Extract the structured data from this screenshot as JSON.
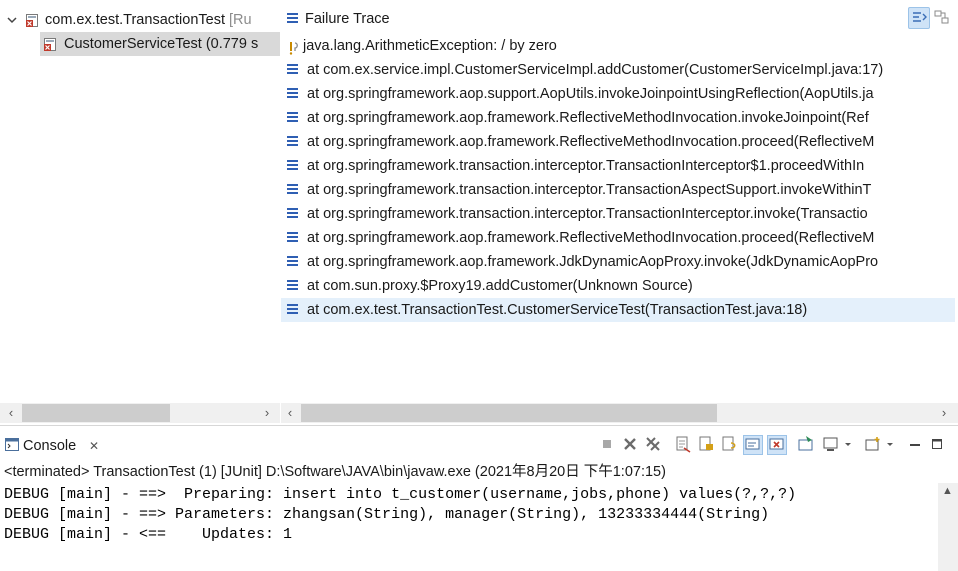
{
  "tree": {
    "suite_label": "com.ex.test.TransactionTest",
    "suite_suffix": "[Ru",
    "test_label": "CustomerServiceTest (0.779 s"
  },
  "trace": {
    "title": "Failure Trace",
    "exception": "java.lang.ArithmeticException: / by zero",
    "frames": [
      "at com.ex.service.impl.CustomerServiceImpl.addCustomer(CustomerServiceImpl.java:17)",
      "at org.springframework.aop.support.AopUtils.invokeJoinpointUsingReflection(AopUtils.ja",
      "at org.springframework.aop.framework.ReflectiveMethodInvocation.invokeJoinpoint(Ref",
      "at org.springframework.aop.framework.ReflectiveMethodInvocation.proceed(ReflectiveM",
      "at org.springframework.transaction.interceptor.TransactionInterceptor$1.proceedWithIn",
      "at org.springframework.transaction.interceptor.TransactionAspectSupport.invokeWithinT",
      "at org.springframework.transaction.interceptor.TransactionInterceptor.invoke(Transactio",
      "at org.springframework.aop.framework.ReflectiveMethodInvocation.proceed(ReflectiveM",
      "at org.springframework.aop.framework.JdkDynamicAopProxy.invoke(JdkDynamicAopPro",
      "at com.sun.proxy.$Proxy19.addCustomer(Unknown Source)",
      "at com.ex.test.TransactionTest.CustomerServiceTest(TransactionTest.java:18)"
    ],
    "selected_index": 10
  },
  "console": {
    "tab_label": "Console",
    "close_glyph": "✕",
    "status": "<terminated> TransactionTest (1) [JUnit] D:\\Software\\JAVA\\bin\\javaw.exe (2021年8月20日 下午1:07:15)",
    "lines": [
      "DEBUG [main] - ==>  Preparing: insert into t_customer(username,jobs,phone) values(?,?,?)",
      "DEBUG [main] - ==> Parameters: zhangsan(String), manager(String), 13233334444(String)",
      "DEBUG [main] - <==    Updates: 1"
    ]
  },
  "colors": {
    "selection": "#e4f0fb",
    "tree_selection": "#d9d9d9",
    "stack_icon": "#2f5fb3",
    "junit_error": "#c0392b"
  }
}
